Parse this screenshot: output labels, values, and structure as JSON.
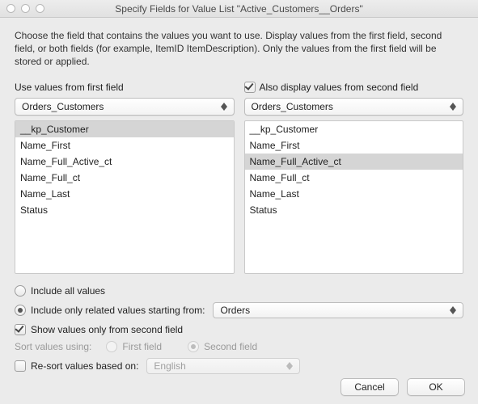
{
  "window": {
    "title": "Specify Fields for Value List \"Active_Customers__Orders\""
  },
  "instructions": "Choose the field that contains the values you want to use.  Display values from the first field, second field, or both fields (for example, ItemID ItemDescription). Only the values from the first field will be stored or applied.",
  "left": {
    "header": "Use values from first field",
    "table": "Orders_Customers",
    "fields": [
      "__kp_Customer",
      "Name_First",
      "Name_Full_Active_ct",
      "Name_Full_ct",
      "Name_Last",
      "Status"
    ],
    "selectedIndex": 0
  },
  "right": {
    "checkboxLabel": "Also display values from second field",
    "checkboxChecked": true,
    "table": "Orders_Customers",
    "fields": [
      "__kp_Customer",
      "Name_First",
      "Name_Full_Active_ct",
      "Name_Full_ct",
      "Name_Last",
      "Status"
    ],
    "selectedIndex": 2
  },
  "options": {
    "includeAll": {
      "label": "Include all values",
      "selected": false
    },
    "includeRelated": {
      "label": "Include only related values starting from:",
      "selected": true,
      "value": "Orders"
    },
    "showSecondOnly": {
      "label": "Show values only from second field",
      "checked": true
    },
    "sortUsing": {
      "label": "Sort values using:",
      "firstLabel": "First field",
      "secondLabel": "Second field",
      "selected": "second",
      "enabled": false
    },
    "resort": {
      "label": "Re-sort values based on:",
      "checked": false,
      "value": "English",
      "enabled": false
    }
  },
  "buttons": {
    "cancel": "Cancel",
    "ok": "OK"
  }
}
